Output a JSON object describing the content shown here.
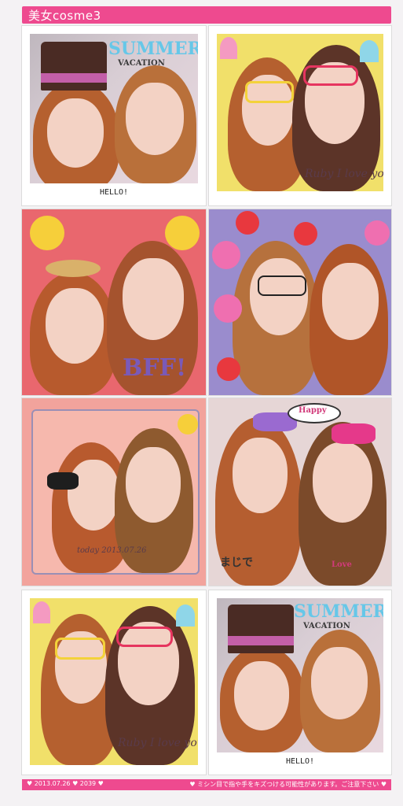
{
  "header": {
    "title": "美女cosme3"
  },
  "footer": {
    "left": "♥ 2013.07.26 ♥ 2039 ♥",
    "right": "♥ ミシン目で指や手をキズつける可能性があります。ご注意下さい ♥"
  },
  "photos": [
    {
      "caption": "HELLO!",
      "sticker_text": "SUMMER",
      "sticker_sub": "VACATION"
    },
    {
      "handwriting": "Ruby I love you"
    },
    {
      "sticker_text": "BFF!"
    },
    {},
    {
      "stamp": "today 2013.07.26"
    },
    {
      "bubble": "Happy",
      "bottom_text": "まじで",
      "badge": "Love"
    },
    {
      "handwriting": "Ruby I love you"
    },
    {
      "caption": "HELLO!",
      "sticker_text": "SUMMER",
      "sticker_sub": "VACATION"
    }
  ],
  "colors": {
    "brand_pink": "#ee4a8f"
  }
}
